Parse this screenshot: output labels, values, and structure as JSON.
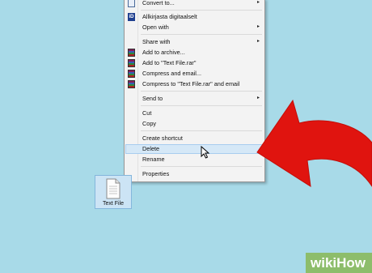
{
  "menu": {
    "items": [
      {
        "label": "Convert to...",
        "arrow": true,
        "icon": "image-icon"
      },
      {
        "label": "Allkirjasta digitaalselt",
        "arrow": false,
        "icon": "id-card-icon"
      },
      {
        "label": "Open with",
        "arrow": true,
        "icon": ""
      },
      {
        "label": "Share with",
        "arrow": true,
        "icon": ""
      },
      {
        "label": "Add to archive...",
        "arrow": false,
        "icon": "winrar-icon"
      },
      {
        "label": "Add to \"Text File.rar\"",
        "arrow": false,
        "icon": "winrar-icon"
      },
      {
        "label": "Compress and email...",
        "arrow": false,
        "icon": "winrar-icon"
      },
      {
        "label": "Compress to \"Text File.rar\" and email",
        "arrow": false,
        "icon": "winrar-icon"
      },
      {
        "label": "Send to",
        "arrow": true,
        "icon": ""
      },
      {
        "label": "Cut",
        "arrow": false,
        "icon": ""
      },
      {
        "label": "Copy",
        "arrow": false,
        "icon": ""
      },
      {
        "label": "Create shortcut",
        "arrow": false,
        "icon": ""
      },
      {
        "label": "Delete",
        "arrow": false,
        "icon": "",
        "highlighted": true
      },
      {
        "label": "Rename",
        "arrow": false,
        "icon": ""
      },
      {
        "label": "Properties",
        "arrow": false,
        "icon": ""
      }
    ],
    "arrow_glyph": "▸",
    "id_glyph": "iD"
  },
  "file": {
    "name": "Text File",
    "icon": "text-document-icon"
  },
  "pointer": {
    "icon": "mouse-cursor-icon"
  },
  "annotation": {
    "icon": "red-curved-arrow-icon",
    "color": "#e0140f"
  },
  "watermark": {
    "brand_a": "wiki",
    "brand_b": "How"
  },
  "colors": {
    "desktop": "#a8dae8",
    "highlight": "#d5e8f7",
    "watermark": "#8dbd6b"
  }
}
